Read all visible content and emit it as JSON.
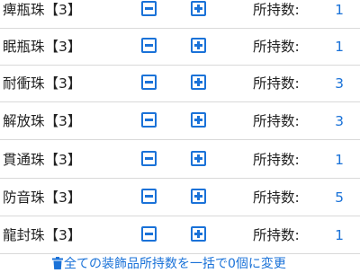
{
  "owned_label": "所持数:",
  "items": [
    {
      "name": "痺瓶珠【3】",
      "count": "1"
    },
    {
      "name": "眠瓶珠【3】",
      "count": "1"
    },
    {
      "name": "耐衝珠【3】",
      "count": "3"
    },
    {
      "name": "解放珠【3】",
      "count": "3"
    },
    {
      "name": "貫通珠【3】",
      "count": "1"
    },
    {
      "name": "防音珠【3】",
      "count": "5"
    },
    {
      "name": "龍封珠【3】",
      "count": "1"
    }
  ],
  "reset_action": {
    "label": "全ての装飾品所持数を一括で0個に変更",
    "icon": "trash-icon"
  },
  "colors": {
    "accent": "#1a72d8",
    "divider": "#d9d9d9",
    "text": "#222222"
  }
}
